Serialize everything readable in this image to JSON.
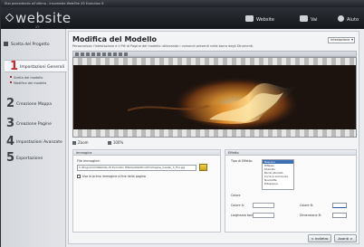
{
  "window": {
    "title": "Stai procedendo all'ultimo - Incomedia WebSite X5 Evolution 8"
  },
  "header": {
    "logo_text": "website",
    "logo_sub": "X5",
    "items": [
      {
        "label": "Website",
        "icon": "globe-icon"
      },
      {
        "label": "Vai",
        "icon": "monitor-icon"
      },
      {
        "label": "Aiuto",
        "icon": "help-icon"
      }
    ]
  },
  "sidebar": {
    "home_label": "Scelta del Progetto",
    "steps": [
      {
        "num": "1",
        "label": "Impostazioni Generali"
      },
      {
        "num": "2",
        "label": "Creazione Mappa"
      },
      {
        "num": "3",
        "label": "Creazione Pagine"
      },
      {
        "num": "4",
        "label": "Impostazioni Avanzate"
      },
      {
        "num": "5",
        "label": "Esportazione"
      }
    ],
    "subitems": [
      "Scelta del modello",
      "Modifica del modello"
    ]
  },
  "main": {
    "title": "Modifica del Modello",
    "description": "Personalizza l'intestazione e il Piè di Pagina del modello utilizzando i comandi presenti nella barra degli Strumenti.",
    "dropdown_value": "Intestazione",
    "zoom": {
      "label_fit": "Zoom",
      "value": "100%"
    }
  },
  "image_panel": {
    "title": "Immagine",
    "file_label": "File Immagine:",
    "file_path": "C:\\Programmi\\WebSite X5 Evolution 8\\Template\\Sfondi\\Immagine_header_3_Fire.jpg",
    "checkbox_label": "Usa la prima immagine a fine della pagina"
  },
  "fx_panel": {
    "title": "Effetto",
    "type_label": "Tipo di Effetto:",
    "effects": [
      "Nessuno",
      "Riflesso",
      "Sfumato",
      "Bordo sfumato",
      "Cornice scorrevole",
      "Nuvolette",
      "Pulsazione"
    ],
    "selected_index": 0,
    "color_section_label": "Colore",
    "fields": [
      {
        "label": "Colore A:"
      },
      {
        "label": "Colore B:"
      },
      {
        "label": "Larghezza bordo:"
      },
      {
        "label": "Dimensione B:"
      }
    ]
  },
  "buttons": {
    "back": "< Indietro",
    "next": "Avanti >"
  },
  "colors": {
    "accent": "#c22b2b",
    "header_bg": "#1f2227",
    "fire": "#f2a133"
  }
}
